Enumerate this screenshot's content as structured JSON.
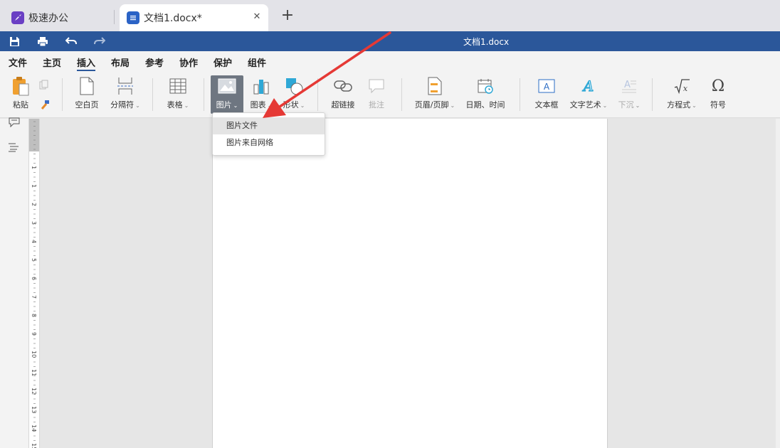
{
  "tabs": [
    {
      "label": "极速办公",
      "icon": "rocket-icon"
    },
    {
      "label": "文档1.docx*",
      "icon": "document-icon"
    }
  ],
  "title_bar": {
    "doc_title": "文档1.docx"
  },
  "menu": {
    "items": [
      "文件",
      "主页",
      "插入",
      "布局",
      "参考",
      "协作",
      "保护",
      "组件"
    ],
    "active": "插入"
  },
  "ribbon": {
    "paste": "粘贴",
    "blank_page": "空白页",
    "page_break": "分隔符",
    "table": "表格",
    "image": "图片",
    "chart": "图表",
    "shape": "形状",
    "hyperlink": "超链接",
    "comment": "批注",
    "header_footer": "页眉/页脚",
    "date_time": "日期、时间",
    "text_box": "文本框",
    "word_art": "文字艺术",
    "drop_cap": "下沉",
    "equation": "方程式",
    "symbol": "符号"
  },
  "image_menu": {
    "items": [
      "图片文件",
      "图片来自网络"
    ],
    "highlighted": "图片文件"
  },
  "ruler": {
    "numbers": [
      "1",
      "1",
      "2",
      "3",
      "4",
      "5",
      "6",
      "7",
      "8",
      "9",
      "10",
      "11",
      "12",
      "13",
      "14",
      "15"
    ]
  },
  "colors": {
    "title_bar": "#2b579a",
    "accent": "#2b579a",
    "annotation_arrow": "#e53935"
  }
}
